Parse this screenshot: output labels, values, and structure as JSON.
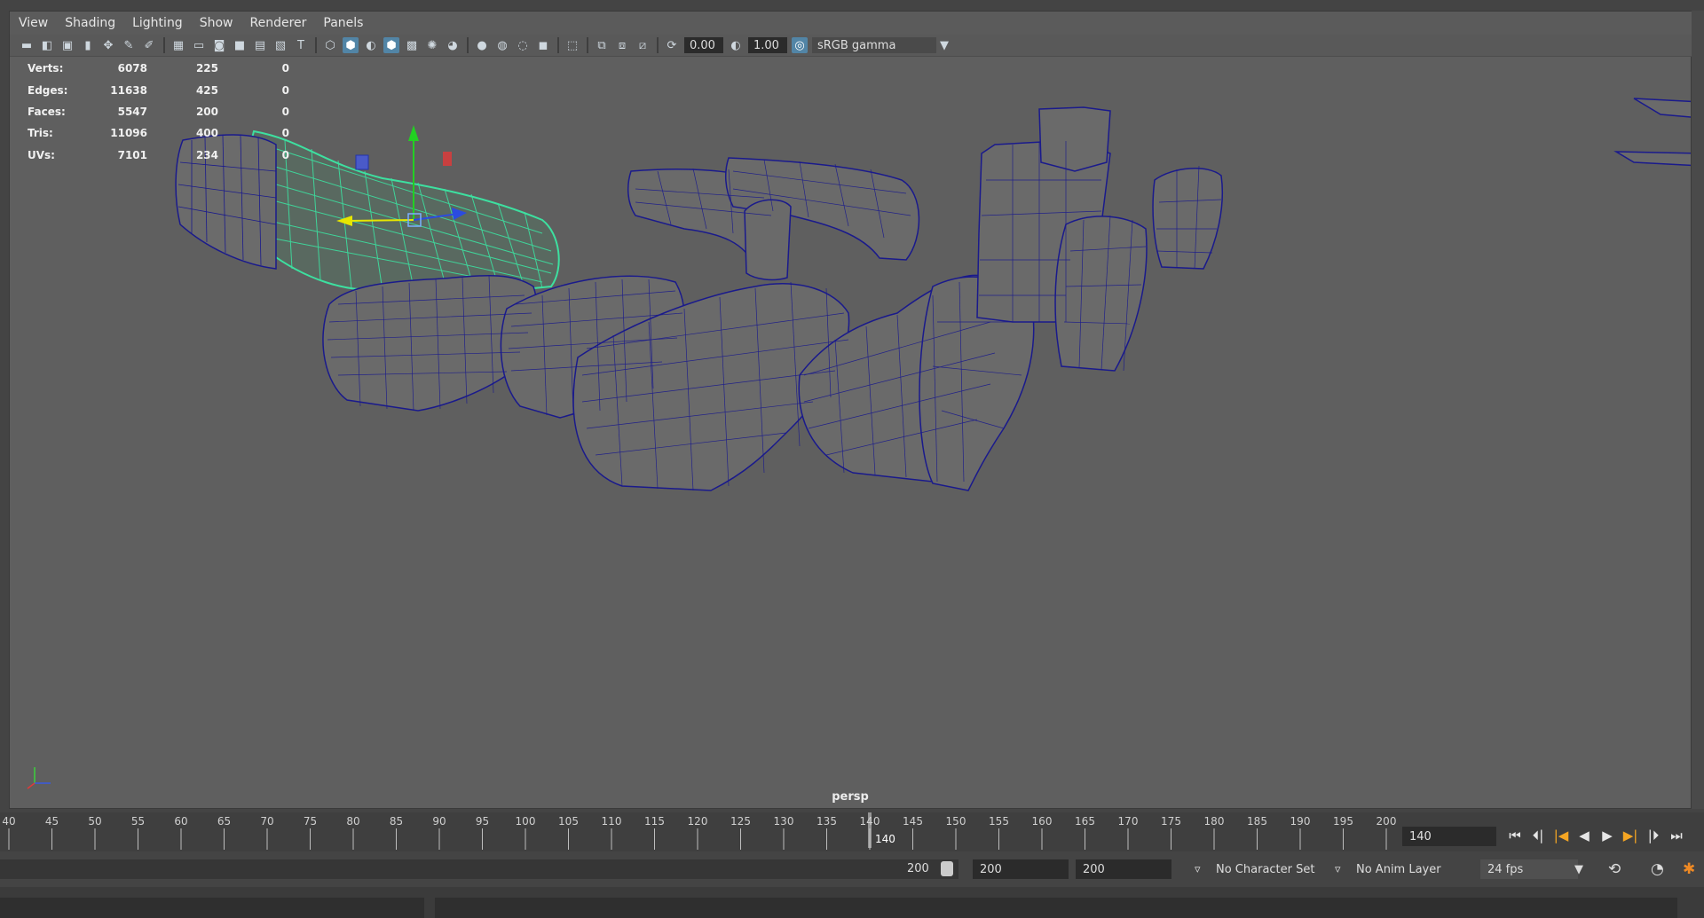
{
  "menu": [
    "View",
    "Shading",
    "Lighting",
    "Show",
    "Renderer",
    "Panels"
  ],
  "toolbar": {
    "exposure_value": "0.00",
    "gamma_value": "1.00",
    "color_space": "sRGB gamma"
  },
  "hud": {
    "rows": [
      {
        "label": "Verts:",
        "a": "6078",
        "b": "225",
        "c": "0"
      },
      {
        "label": "Edges:",
        "a": "11638",
        "b": "425",
        "c": "0"
      },
      {
        "label": "Faces:",
        "a": "5547",
        "b": "200",
        "c": "0"
      },
      {
        "label": "Tris:",
        "a": "11096",
        "b": "400",
        "c": "0"
      },
      {
        "label": "UVs:",
        "a": "7101",
        "b": "234",
        "c": "0"
      }
    ]
  },
  "viewport": {
    "camera": "persp"
  },
  "timeline": {
    "ticks": [
      "40",
      "45",
      "50",
      "55",
      "60",
      "65",
      "70",
      "75",
      "80",
      "85",
      "90",
      "95",
      "100",
      "105",
      "110",
      "115",
      "120",
      "125",
      "130",
      "135",
      "140",
      "145",
      "150",
      "155",
      "160",
      "165",
      "170",
      "175",
      "180",
      "185",
      "190",
      "195",
      "200"
    ],
    "current_frame": "140",
    "current_frame_field": "140"
  },
  "range": {
    "range_end_label": "200",
    "anim_end": "200",
    "playback_end": "200",
    "character_set": "No Character Set",
    "anim_layer": "No Anim Layer",
    "fps": "24 fps"
  },
  "colors": {
    "viewport_bg": "#5f5f5f",
    "wireframe": "#1a1a8c",
    "selected_wire": "#40f0a0",
    "active_toolbar": "#5285a6"
  }
}
